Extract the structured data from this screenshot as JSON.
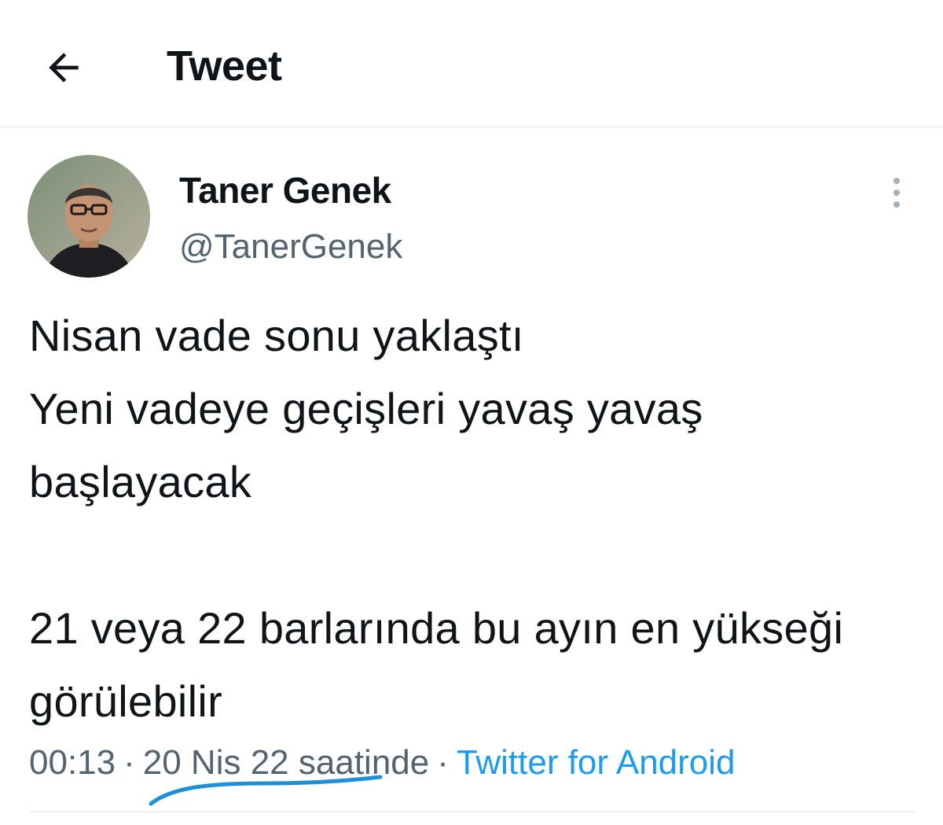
{
  "header": {
    "title": "Tweet",
    "back_icon": "arrow-left-icon"
  },
  "author": {
    "display_name": "Taner Genek",
    "handle": "@TanerGenek",
    "avatar_icon": "avatar"
  },
  "tweet": {
    "text": "Nisan vade sonu yaklaştı\nYeni vadeye geçişleri yavaş yavaş başlayacak\n\n21 veya 22 barlarında bu ayın en yükseği görülebilir"
  },
  "meta": {
    "time": "00:13",
    "separator": "·",
    "date": "20 Nis 22",
    "date_suffix": "saatinde",
    "source": "Twitter for Android"
  },
  "colors": {
    "accent": "#1d9bf0",
    "muted": "#536471",
    "text": "#0f1419",
    "annotation": "#1d8fd6"
  }
}
